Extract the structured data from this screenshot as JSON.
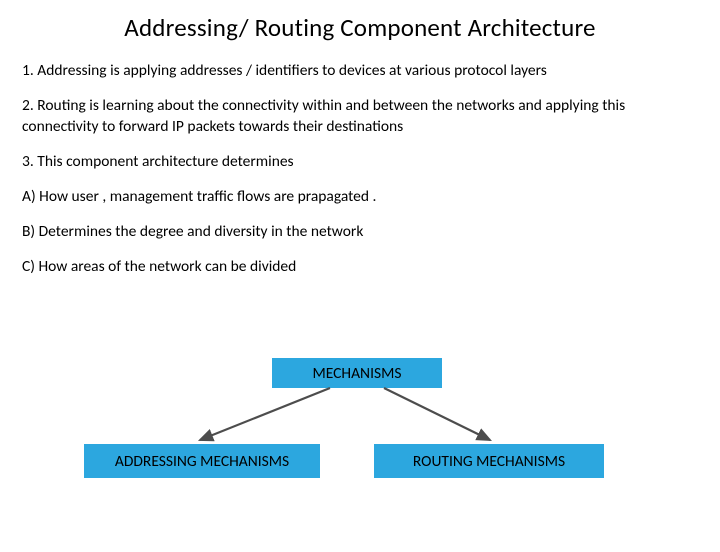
{
  "title": "Addressing/ Routing Component Architecture",
  "paragraphs": {
    "p1": "1. Addressing is applying addresses / identifiers  to devices at various protocol layers",
    "p2": "2. Routing is learning about the connectivity  within and between   the networks  and applying this connectivity to  forward IP packets  towards their destinations",
    "p3": "3.   This component architecture  determines",
    "pA": "A)   How user  , management  traffic flows are prapagated .",
    "pB": "B)   Determines the degree and diversity  in the network",
    "pC": "C)   How areas of the network can be divided"
  },
  "diagram": {
    "top": "MECHANISMS",
    "left": "ADDRESSING MECHANISMS",
    "right": "ROUTING MECHANISMS"
  }
}
